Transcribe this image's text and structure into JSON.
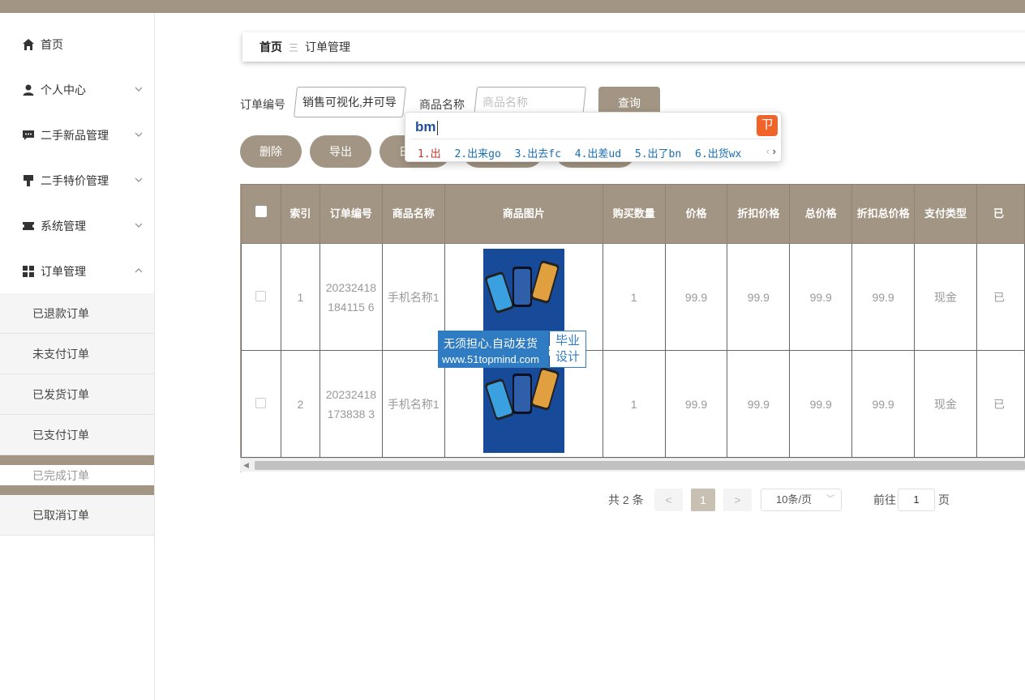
{
  "sidebar": {
    "items": [
      {
        "label": "首页",
        "icon": "home-icon"
      },
      {
        "label": "个人中心",
        "icon": "user-icon"
      },
      {
        "label": "二手新品管理",
        "icon": "chat-icon"
      },
      {
        "label": "二手特价管理",
        "icon": "brush-icon"
      },
      {
        "label": "系统管理",
        "icon": "ticket-icon"
      },
      {
        "label": "订单管理",
        "icon": "grid-icon"
      }
    ],
    "order_sub": [
      "已退款订单",
      "未支付订单",
      "已发货订单",
      "已支付订单",
      "已完成订单",
      "已取消订单"
    ]
  },
  "breadcrumb": {
    "home": "首页",
    "separator": "三",
    "current": "订单管理"
  },
  "search": {
    "order_no_label": "订单编号",
    "order_no_value": "销售可视化,并可导",
    "product_label": "商品名称",
    "product_placeholder": "商品名称",
    "query_label": "查询"
  },
  "actions": {
    "delete": "删除",
    "export": "导出",
    "partial": "日"
  },
  "ime": {
    "composition": "bm",
    "candidates": [
      "1.出",
      "2.出来go",
      "3.出去fc",
      "4.出差ud",
      "5.出了bn",
      "6.出货wx"
    ]
  },
  "table": {
    "headers": [
      "索引",
      "订单编号",
      "商品名称",
      "商品图片",
      "购买数量",
      "价格",
      "折扣价格",
      "总价格",
      "折扣总价格",
      "支付类型",
      "已"
    ],
    "rows": [
      {
        "index": "1",
        "order_no": "20232418184115 6",
        "product": "手机名称1",
        "qty": "1",
        "price": "99.9",
        "discount_price": "99.9",
        "total": "99.9",
        "discount_total": "99.9",
        "pay": "现金",
        "status": "已"
      },
      {
        "index": "2",
        "order_no": "20232418173838 3",
        "product": "手机名称1",
        "qty": "1",
        "price": "99.9",
        "discount_price": "99.9",
        "total": "99.9",
        "discount_total": "99.9",
        "pay": "现金",
        "status": "已"
      }
    ]
  },
  "watermark": {
    "line1": "无须担心.自动发货",
    "line2": "www.51topmind.com",
    "right1": "毕业",
    "right2": "设计"
  },
  "pagination": {
    "total": "共 2 条",
    "prev": "<",
    "current": "1",
    "next": ">",
    "size": "10条/页",
    "goto": "前往",
    "page_value": "1",
    "page_unit": "页"
  },
  "colors": {
    "accent": "#a39583",
    "watermark": "#2f7cc2"
  }
}
